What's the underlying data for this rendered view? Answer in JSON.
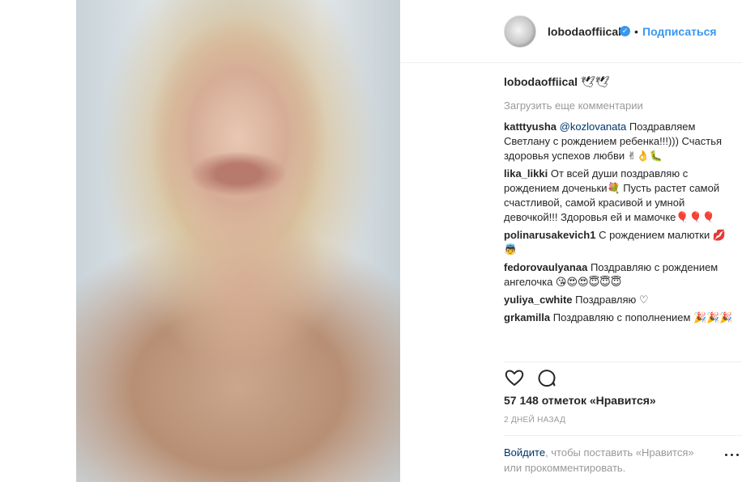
{
  "post": {
    "owner_username": "lobodaoffiical",
    "verified_icon": "check-badge-icon",
    "separator": "•",
    "follow_label": "Подписаться",
    "caption_text": "🕊🕊",
    "load_more_label": "Загрузить еще комментарии"
  },
  "comments": [
    {
      "user": "katttyusha",
      "mention": "@kozlovanata",
      "text": " Поздравляем Светлану с рождением ребенка!!!))) Счастья здоровья успехов любви ✌👌🐛"
    },
    {
      "user": "lika_likki",
      "mention": "",
      "text": " От всей души поздравляю с рождением доченьки💐 Пусть растет самой счастливой, самой красивой и умной девочкой!!! Здоровья ей и мамочке🎈🎈🎈"
    },
    {
      "user": "polinarusakevich1",
      "mention": "",
      "text": " С рождением малютки 💋👼"
    },
    {
      "user": "fedorovaulyanaa",
      "mention": "",
      "text": " Поздравляю с рождением ангелочка 😘😍😍😇😇😇"
    },
    {
      "user": "yuliya_cwhite",
      "mention": "",
      "text": " Поздравляю ♡"
    },
    {
      "user": "grkamilla",
      "mention": "",
      "text": " Поздравляю с пополнением 🎉🎉🎉"
    }
  ],
  "actions": {
    "like_icon": "heart-outline-icon",
    "comment_icon": "speech-bubble-icon"
  },
  "likes_text": "57 148 отметок «Нравится»",
  "time_text": "2 ДНЕЙ НАЗАД",
  "login_prompt": {
    "link_label": "Войдите",
    "rest_text": ", чтобы поставить «Нравится» или прокомментировать."
  },
  "more_icon": "more-options-icon",
  "colors": {
    "accent": "#3897f0",
    "text": "#262626",
    "muted": "#999999",
    "link": "#003569",
    "divider": "#efefef"
  }
}
